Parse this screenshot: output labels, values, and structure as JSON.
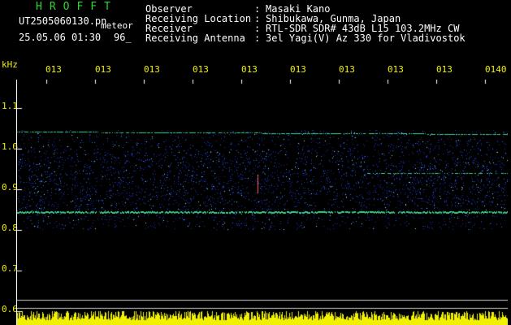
{
  "header": {
    "brand": "HROFFT",
    "filename": "UT2505060130.pn",
    "meteor": "meteor",
    "date": "25.05.06 01:30",
    "count": "96_",
    "rows": [
      {
        "label": "Observer",
        "value": "Masaki Kano"
      },
      {
        "label": "Receiving Location",
        "value": "Shibukawa, Gunma, Japan"
      },
      {
        "label": "Receiver",
        "value": "RTL-SDR SDR# 43dB L15 103.2MHz CW"
      },
      {
        "label": "Receiving Antenna",
        "value": "3el Yagi(V) Az 330 for Vladivostok"
      }
    ],
    "colon": ":"
  },
  "axis": {
    "unit": "kHz",
    "y_ticks": [
      "1.1",
      "1.0",
      "0.9",
      "0.8",
      "0.7",
      "0.6"
    ],
    "time_ticks": [
      "013",
      "013",
      "013",
      "013",
      "013",
      "013",
      "013",
      "013",
      "013",
      "0140"
    ]
  },
  "colors": {
    "label_green": "#2fd62f",
    "text_white": "#ffffff",
    "tick_yellow": "#f0f000",
    "echo_line": "#3fd08a",
    "noise_blue": "#1a3fe0"
  }
}
